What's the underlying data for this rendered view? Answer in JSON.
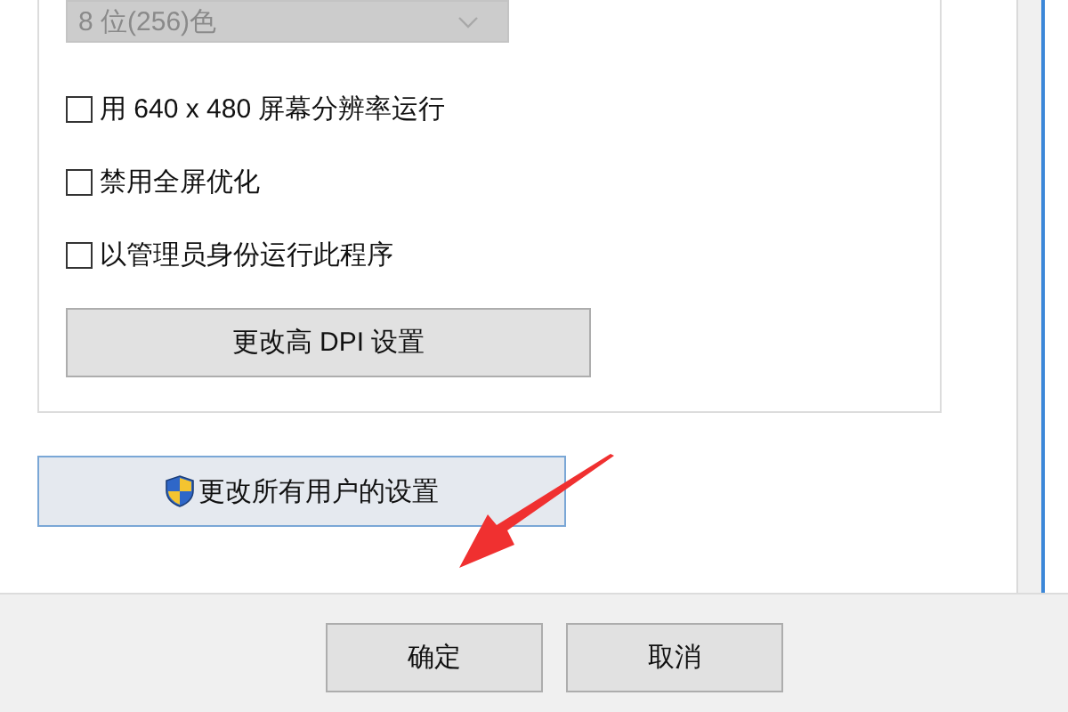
{
  "group": {
    "color_depth": {
      "value": "8 位(256)色",
      "disabled": true
    },
    "options": [
      {
        "label": "用 640 x 480 屏幕分辨率运行",
        "checked": false
      },
      {
        "label": "禁用全屏优化",
        "checked": false
      },
      {
        "label": "以管理员身份运行此程序",
        "checked": false
      }
    ],
    "dpi_button": "更改高 DPI 设置"
  },
  "all_users_button": "更改所有用户的设置",
  "buttons": [
    "确定",
    "取消"
  ],
  "annotation": {
    "kind": "arrow"
  }
}
